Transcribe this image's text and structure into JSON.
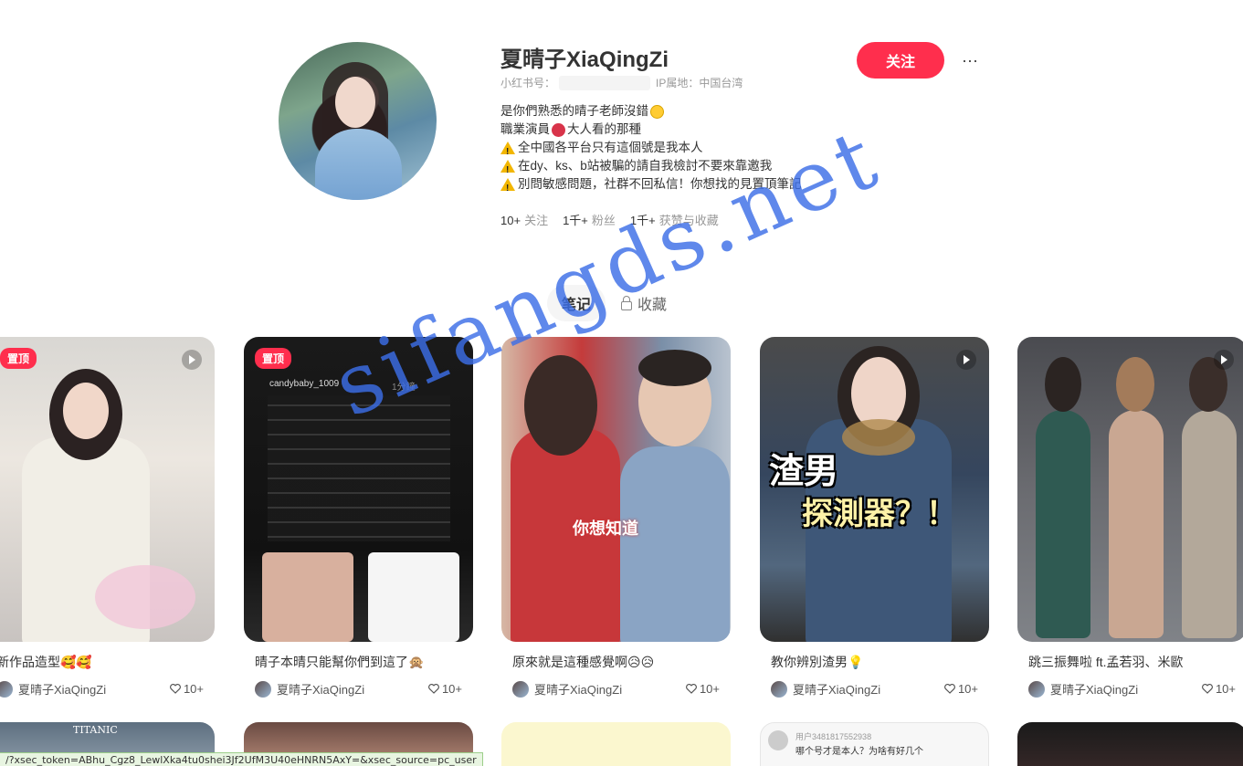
{
  "profile": {
    "nickname": "夏晴子XiaQingZi",
    "id_label": "小红书号：",
    "ip_label": "IP属地：中国台湾",
    "follow_label": "关注",
    "more_label": "···",
    "bio": [
      {
        "text": "是你們熟悉的晴子老師沒錯",
        "emoji_after": "smile"
      },
      {
        "text_before": "職業演員",
        "emoji": "devil",
        "text_after": "大人看的那種"
      },
      {
        "warn": true,
        "text": "全中國各平台只有這個號是我本人"
      },
      {
        "warn": true,
        "text": "在dy、ks、b站被騙的請自我檢討不要來靠邀我"
      },
      {
        "warn": true,
        "text": "別問敏感問題，社群不回私信！你想找的見置頂筆記"
      }
    ],
    "stats": [
      {
        "num": "10+",
        "label": "关注"
      },
      {
        "num": "1千+",
        "label": "粉丝"
      },
      {
        "num": "1千+",
        "label": "获赞与收藏"
      }
    ]
  },
  "tabs": {
    "notes": "笔记",
    "collect": "收藏"
  },
  "cards": [
    {
      "title": "新作品造型🥰🥰",
      "author": "夏晴子XiaQingZi",
      "likes": "10+",
      "pinned": "置顶"
    },
    {
      "title": "晴子本晴只能幫你們到這了🙊",
      "author": "夏晴子XiaQingZi",
      "likes": "10+",
      "pinned": "置顶"
    },
    {
      "title": "原來就是這種感覺啊😥😥",
      "author": "夏晴子XiaQingZi",
      "likes": "10+"
    },
    {
      "title": "教你辨別渣男💡",
      "author": "夏晴子XiaQingZi",
      "likes": "10+"
    },
    {
      "title": "跳三振舞啦 ft.孟若羽、米歐",
      "author": "夏晴子XiaQingZi",
      "likes": "10+"
    }
  ],
  "cover_texts": {
    "card3": "你想知道",
    "card4_line1": "渣男",
    "card4_line2": "探測器？！",
    "card2_user": "candybaby_1009",
    "card2_time": "1分鐘",
    "row2_card4_user": "用户3481817552938",
    "row2_card4_text": "哪个号才是本人？为啥有好几个",
    "row2_card1_text": "TITANIC"
  },
  "status_url": "/?xsec_token=ABhu_Cgz8_LewlXka4tu0shei3Jf2UfM3U40eHNRN5AxY=&xsec_source=pc_user",
  "watermark": "sifangds.net"
}
